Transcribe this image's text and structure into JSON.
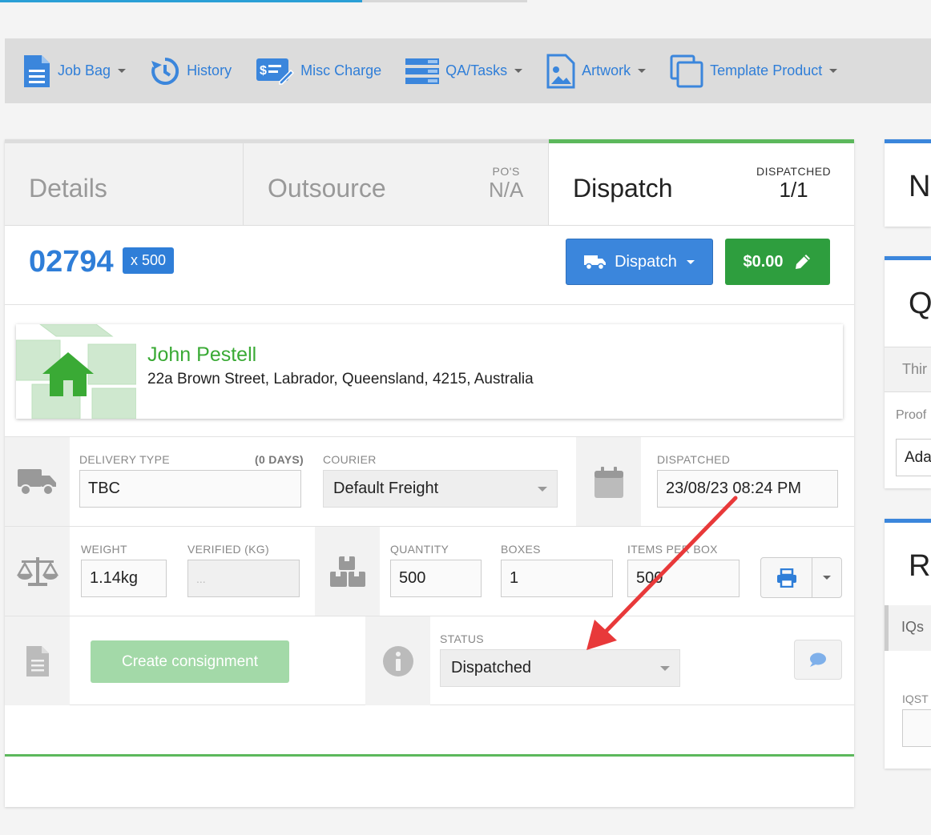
{
  "toolbar": {
    "items": [
      {
        "label": "Job Bag",
        "icon": "document-icon",
        "dropdown": true
      },
      {
        "label": "History",
        "icon": "history-icon",
        "dropdown": false
      },
      {
        "label": "Misc Charge",
        "icon": "misc-charge-icon",
        "dropdown": false
      },
      {
        "label": "QA/Tasks",
        "icon": "tasks-icon",
        "dropdown": true
      },
      {
        "label": "Artwork",
        "icon": "image-icon",
        "dropdown": true
      },
      {
        "label": "Template Product",
        "icon": "copy-icon",
        "dropdown": true
      }
    ]
  },
  "tabs": {
    "details": "Details",
    "outsource": "Outsource",
    "outsource_sub_label": "PO'S",
    "outsource_sub_value": "N/A",
    "dispatch": "Dispatch",
    "dispatch_sub_label": "DISPATCHED",
    "dispatch_sub_value": "1/1"
  },
  "job": {
    "number": "02794",
    "qty_badge": "x 500",
    "dispatch_button": "Dispatch",
    "price_button": "$0.00"
  },
  "address": {
    "name": "John Pestell",
    "line": "22a Brown Street, Labrador, Queensland, 4215, Australia"
  },
  "delivery": {
    "delivery_type_label": "DELIVERY TYPE",
    "days_label": "(0 DAYS)",
    "delivery_type_value": "TBC",
    "courier_label": "COURIER",
    "courier_value": "Default Freight",
    "dispatched_label": "DISPATCHED",
    "dispatched_value": "23/08/23 08:24 PM"
  },
  "weights": {
    "weight_label": "WEIGHT",
    "weight_value": "1.14kg",
    "verified_label": "VERIFIED (KG)",
    "verified_placeholder": "...",
    "quantity_label": "QUANTITY",
    "quantity_value": "500",
    "boxes_label": "BOXES",
    "boxes_value": "1",
    "items_per_box_label": "ITEMS PER BOX",
    "items_per_box_value": "500"
  },
  "consignment": {
    "button": "Create consignment",
    "status_label": "STATUS",
    "status_value": "Dispatched"
  },
  "right_cards": {
    "card1_letter": "N",
    "card2_letter": "Q",
    "card2_tab": "Thir",
    "card2_label": "Proof",
    "card2_input": "Ada",
    "card3_letter": "R",
    "card3_tab": "IQs",
    "card3_label": "IQST"
  },
  "colors": {
    "accent_blue": "#3b86dc",
    "success_green": "#2e9e3e",
    "tab_active_border": "#5cb85c",
    "annotation_arrow": "#e8393a"
  }
}
